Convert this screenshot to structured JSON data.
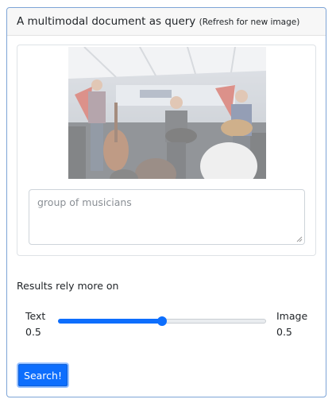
{
  "header": {
    "title": "A multimodal document as query",
    "hint": "(Refresh for new image)"
  },
  "query": {
    "image_description_icon": "concert-photo",
    "text_value": "group of musicians"
  },
  "weight": {
    "label": "Results rely more on",
    "left_label": "Text",
    "left_value": "0.5",
    "right_label": "Image",
    "right_value": "0.5",
    "slider_value": 0.5
  },
  "search_button": {
    "label": "Search!"
  },
  "colors": {
    "accent": "#0d6efd",
    "border": "#7da4d6"
  }
}
